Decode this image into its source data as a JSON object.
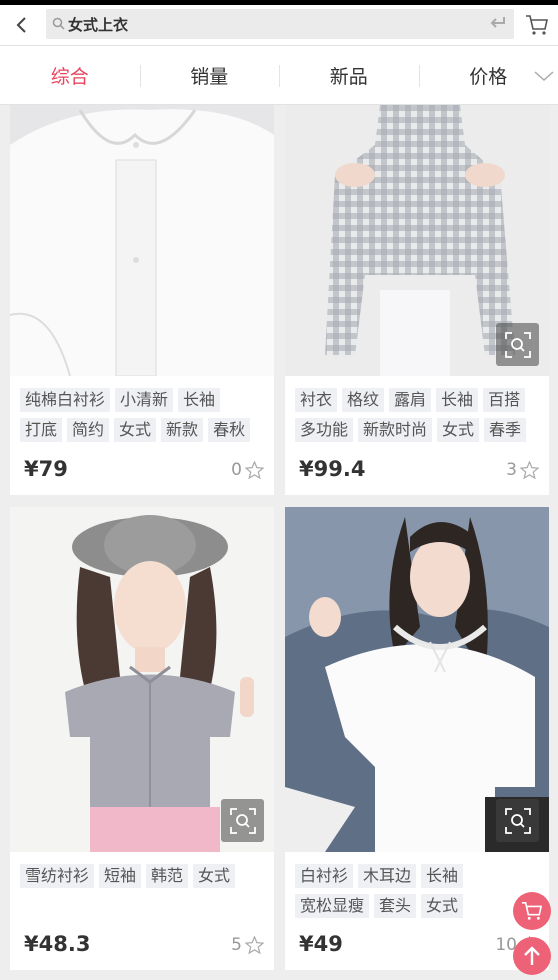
{
  "search": {
    "query": "女式上衣"
  },
  "sort_tabs": [
    {
      "label": "综合",
      "active": true
    },
    {
      "label": "销量",
      "active": false
    },
    {
      "label": "新品",
      "active": false
    },
    {
      "label": "价格",
      "active": false
    }
  ],
  "products": [
    {
      "tags": [
        "纯棉白衬衫",
        "小清新",
        "长袖",
        "打底",
        "简约",
        "女式",
        "新款",
        "春秋"
      ],
      "price": "¥79",
      "likes": "0"
    },
    {
      "tags": [
        "衬衣",
        "格纹",
        "露肩",
        "长袖",
        "百搭",
        "多功能",
        "新款时尚",
        "女式",
        "春季"
      ],
      "price": "¥99.4",
      "likes": "3"
    },
    {
      "tags": [
        "雪纺衬衫",
        "短袖",
        "韩范",
        "女式"
      ],
      "price": "¥48.3",
      "likes": "5"
    },
    {
      "tags": [
        "白衬衫",
        "木耳边",
        "长袖",
        "宽松显瘦",
        "套头",
        "女式"
      ],
      "price": "¥49",
      "likes": "10"
    }
  ],
  "colors": {
    "accent": "#e8455d",
    "float_button": "#ee6277",
    "tag_bg": "#eef0f4"
  },
  "icons": [
    "back-arrow-icon",
    "search-icon",
    "enter-icon",
    "cart-icon",
    "chevron-down-icon",
    "zoom-icon",
    "star-icon",
    "arrow-up-icon"
  ]
}
